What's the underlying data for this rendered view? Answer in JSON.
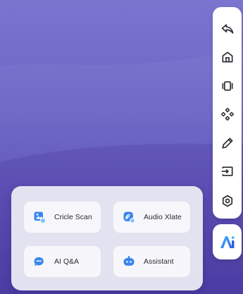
{
  "toolbar": {
    "items": [
      {
        "name": "back",
        "icon": "back-arrow-icon"
      },
      {
        "name": "home",
        "icon": "home-icon"
      },
      {
        "name": "window",
        "icon": "window-switch-icon"
      },
      {
        "name": "navigate",
        "icon": "dpad-icon"
      },
      {
        "name": "annotate",
        "icon": "pencil-icon"
      },
      {
        "name": "input-source",
        "icon": "input-source-icon"
      },
      {
        "name": "settings",
        "icon": "settings-icon"
      }
    ],
    "ai_button": {
      "icon": "ai-logo-icon"
    }
  },
  "quick_panel": {
    "items": [
      {
        "label": "Cricle Scan",
        "icon": "circle-scan-icon"
      },
      {
        "label": "Audio Xlate",
        "icon": "audio-translate-icon"
      },
      {
        "label": "AI Q&A",
        "icon": "ai-qa-icon"
      },
      {
        "label": "Assistant",
        "icon": "assistant-icon"
      }
    ]
  },
  "colors": {
    "accent": "#3a86f0",
    "icon_dark": "#2a2a32",
    "background_top": "#7a75cf",
    "background_bottom": "#473aa5"
  }
}
